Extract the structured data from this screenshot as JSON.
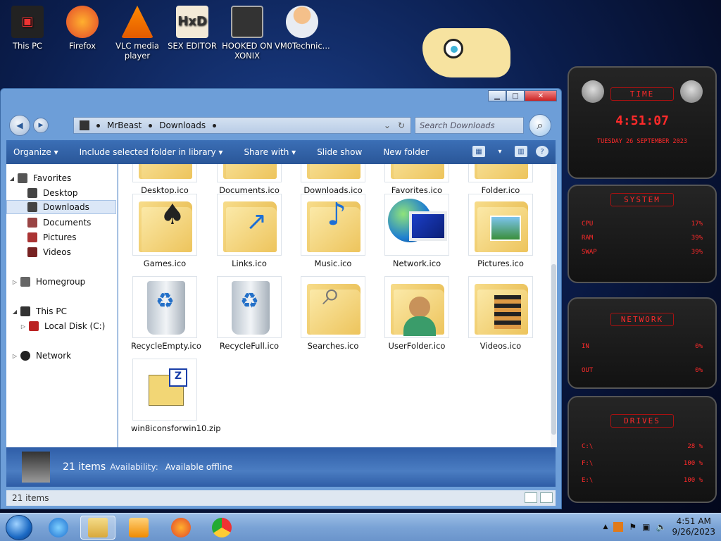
{
  "desktop": {
    "icons": [
      {
        "label": "This PC"
      },
      {
        "label": "Firefox"
      },
      {
        "label": "VLC media player"
      },
      {
        "label": "SEX EDITOR"
      },
      {
        "label": "HOOKED ON XONIX"
      },
      {
        "label": "VM0Technic..."
      }
    ]
  },
  "explorer": {
    "breadcrumb": [
      "MrBeast",
      "Downloads"
    ],
    "search_placeholder": "Search Downloads",
    "commands": {
      "organize": "Organize",
      "include": "Include selected folder in library",
      "share": "Share with",
      "slideshow": "Slide show",
      "newfolder": "New folder"
    },
    "nav": {
      "favorites": "Favorites",
      "desktop": "Desktop",
      "downloads": "Downloads",
      "documents": "Documents",
      "pictures": "Pictures",
      "videos": "Videos",
      "homegroup": "Homegroup",
      "thispc": "This PC",
      "localdisk": "Local Disk (C:)",
      "network": "Network"
    },
    "files": [
      {
        "name": "Desktop.ico"
      },
      {
        "name": "Documents.ico"
      },
      {
        "name": "Downloads.ico"
      },
      {
        "name": "Favorites.ico"
      },
      {
        "name": "Folder.ico"
      },
      {
        "name": "Games.ico"
      },
      {
        "name": "Links.ico"
      },
      {
        "name": "Music.ico"
      },
      {
        "name": "Network.ico"
      },
      {
        "name": "Pictures.ico"
      },
      {
        "name": "RecycleEmpty.ico"
      },
      {
        "name": "RecycleFull.ico"
      },
      {
        "name": "Searches.ico"
      },
      {
        "name": "UserFolder.ico"
      },
      {
        "name": "Videos.ico"
      },
      {
        "name": "win8iconsforwin10.zip"
      }
    ],
    "details": {
      "count": "21 items",
      "availability_label": "Availability:",
      "availability_value": "Available offline"
    },
    "status": "21 items"
  },
  "widgets": {
    "time": {
      "title": "TIME",
      "clock": "4:51:07",
      "date": "TUESDAY 26 SEPTEMBER 2023"
    },
    "system": {
      "title": "SYSTEM",
      "cpu_label": "CPU",
      "cpu": "17%",
      "ram_label": "RAM",
      "ram": "39%",
      "swap_label": "SWAP",
      "swap": "39%"
    },
    "network": {
      "title": "NETWORK",
      "in_label": "IN",
      "in": "0%",
      "out_label": "OUT",
      "out": "0%"
    },
    "drives": {
      "title": "DRIVES",
      "c_label": "C:\\",
      "c": "28 %",
      "f_label": "F:\\",
      "f": "100 %",
      "e_label": "E:\\",
      "e": "100 %"
    }
  },
  "taskbar": {
    "time": "4:51 AM",
    "date": "9/26/2023"
  }
}
